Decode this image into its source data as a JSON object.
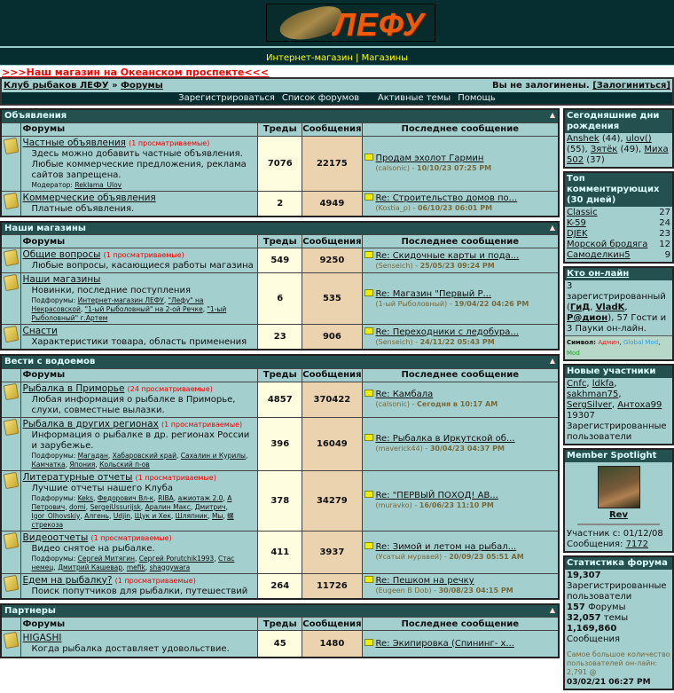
{
  "header": {
    "logo_text": "ЛЕФУ",
    "nav": [
      "Интернет-магазин",
      "Магазины"
    ],
    "nav_sep": " | ",
    "promo": ">>>Наш магазин на Океанском проспекте<<<"
  },
  "breadcrumb": {
    "root": "Клуб рыбаков ЛЕФУ",
    "sep": " » ",
    "current": "Форумы",
    "login_status": "Вы не залогинены.",
    "login_link": "[Залогиниться]"
  },
  "menu": [
    "Зарегистрироваться",
    "Список форумов",
    "Активные темы",
    "Помощь"
  ],
  "columns": {
    "forums": "Форумы",
    "threads": "Треды",
    "posts": "Сообщения",
    "last": "Последнее сообщение"
  },
  "categories": [
    {
      "title": "Объявления",
      "forums": [
        {
          "name": "Частные объявления",
          "viewing": "(1 просматриваемые)",
          "desc": "Здесь можно добавить частные объявления. Любые коммерческие предложения, реклама сайтов запрещена.",
          "sub_label": "Модератор:",
          "subs": [
            "Reklama_Ulov"
          ],
          "threads": "7076",
          "posts": "22175",
          "last_title": "Продам эхолот Гармин",
          "last_user": "(calsonic)",
          "last_date": "10/10/23 07:25 PM",
          "h": 40
        },
        {
          "name": "Коммерческие объявления",
          "viewing": "",
          "desc": "Платные объявления.",
          "threads": "2",
          "posts": "4949",
          "last_title": "Re: Строительство домов по...",
          "last_user": "(Kostia_p)",
          "last_date": "06/10/23 06:01 PM",
          "h": 22
        }
      ]
    },
    {
      "title": "Наши магазины",
      "forums": [
        {
          "name": "Общие вопросы",
          "viewing": "(1 просматриваемые)",
          "desc": "Любые вопросы, касающиеся работы магазина",
          "threads": "549",
          "posts": "9250",
          "last_title": "Re: Скидочные карты и пода...",
          "last_user": "(Senseich)",
          "last_date": "25/05/23 09:24 PM",
          "h": 23
        },
        {
          "name": "Наши магазины",
          "viewing": "",
          "desc": "Новинки, последние поступления",
          "sub_label": "Подфорумы:",
          "subs": [
            "Интернет-магазин ЛЕФУ",
            "\"Лефу\" на Некрасовской",
            "\"1-ый Рыболовный\" на 2-ой Речке",
            "\"1-ый Рыболовный\" г.Артем"
          ],
          "threads": "6",
          "posts": "535",
          "last_title": "Re: Магазин \"Первый Р...",
          "last_user": "(1-ый Рыболовный)",
          "last_date": "19/04/22 04:26 PM",
          "h": 37
        },
        {
          "name": "Снасти",
          "viewing": "",
          "desc": "Характеристики товара, область применения",
          "threads": "23",
          "posts": "906",
          "last_title": "Re: Переходники с ледобура...",
          "last_user": "(Senseich)",
          "last_date": "24/11/22 05:43 PM",
          "h": 23
        }
      ]
    },
    {
      "title": "Вести с водоемов",
      "forums": [
        {
          "name": "Рыбалка в Приморье",
          "viewing": "(24 просматриваемые)",
          "desc": "Любая информация о рыбалке в Приморье, слухи, совместные вылазки.",
          "threads": "4857",
          "posts": "370422",
          "last_title": "Re: Камбала",
          "last_user": "(calsonic)",
          "last_date": "Сегодня в 10:17 AM",
          "h": 30
        },
        {
          "name": "Рыбалка в других регионах",
          "viewing": "(1 просматриваемые)",
          "desc": "Информация о рыбалке в др. регионах России и зарубежье.",
          "sub_label": "Подфорумы:",
          "subs": [
            "Магадан",
            "Хабаровский край",
            "Сахалин и Курилы",
            "Камчатка",
            "Япония",
            "Кольский п-ов"
          ],
          "threads": "396",
          "posts": "16049",
          "last_title": "Re: Рыбалка в Иркутской об...",
          "last_user": "(maverick44)",
          "last_date": "30/04/23 04:37 PM",
          "h": 40
        },
        {
          "name": "Литературные отчеты",
          "viewing": "(1 просматриваемые)",
          "desc": "Лучшие отчеты нашего Клуба",
          "sub_label": "Подфорумы:",
          "subs": [
            "Keks",
            "Федорович Вл-к",
            "RIBA",
            "ажиотаж 2.0",
            "А Петрович",
            "domi",
            "SergeiUssurijsk",
            "Аралин Макс",
            "Дмитрич",
            "Igor_Olhovskiy",
            "Алгень",
            "Udjin",
            "Щук и Хек",
            "Шляпник",
            "Мы",
            "螺стрекоза"
          ],
          "threads": "378",
          "posts": "34279",
          "last_title": "Re: \"ПЕРВЫЙ ПОХОД! АВ...",
          "last_user": "(muravko)",
          "last_date": "16/06/23 11:10 PM",
          "h": 44
        },
        {
          "name": "Видеоотчеты",
          "viewing": "(1 просматриваемые)",
          "desc": "Видео снятое на рыбалке.",
          "sub_label": "Подфорумы:",
          "subs": [
            "Сергей Митягин",
            "Сергей Porutchik1993",
            "Стас немец",
            "Дмитрий Кашевар",
            "mefik",
            "shaggywara"
          ],
          "threads": "411",
          "posts": "3937",
          "last_title": "Re: Зимой и летом на рыбал...",
          "last_user": "(Усатый муравей)",
          "last_date": "20/09/23 05:51 AM",
          "h": 38
        },
        {
          "name": "Едем на рыбалку?",
          "viewing": "(1 просматриваемые)",
          "desc": "Поиск попутчиков для рыбалки, путешествий",
          "threads": "264",
          "posts": "11726",
          "last_title": "Re: Пешком на речку",
          "last_user": "(Eugeen B Dob)",
          "last_date": "30/08/23 04:15 PM",
          "h": 22
        }
      ]
    },
    {
      "title": "Партнеры",
      "forums": [
        {
          "name": "HIGASHI",
          "viewing": "",
          "desc": "Когда рыбалка доставляет удовольствие.",
          "threads": "45",
          "posts": "1480",
          "last_title": "Re: Экипировка (Спининг- х...",
          "last_user": "",
          "last_date": "",
          "h": 30
        }
      ]
    }
  ],
  "sidebar": {
    "birthdays": {
      "title": "Сегодняшние дни рождения",
      "people": [
        {
          "name": "Anshek",
          "age": "(44)"
        },
        {
          "name": "ulov()",
          "age": "(55)"
        },
        {
          "name": "Зятёк",
          "age": "(49)"
        },
        {
          "name": "Миха 502",
          "age": "(37)"
        }
      ]
    },
    "top": {
      "title": "Топ комментирующих (30 дней)",
      "rows": [
        {
          "name": "Classic",
          "n": "27"
        },
        {
          "name": "K-59",
          "n": "24"
        },
        {
          "name": "DJEK",
          "n": "23"
        },
        {
          "name": "Морской бродяга",
          "n": "12"
        },
        {
          "name": "Самоделкин5",
          "n": "9"
        }
      ]
    },
    "online": {
      "title": "Кто он-лайн",
      "pre": "3 зарегистрированный (",
      "users": [
        "ГиД",
        "VladK",
        "Р@дион"
      ],
      "post": "), 57 Гости и 3 Пауки он-лайн.",
      "sym_label": "Символ:",
      "sym": [
        {
          "t": "Админ",
          "c": "#e02020"
        },
        {
          "t": "Global Mod",
          "c": "#30a0e0"
        },
        {
          "t": "Mod",
          "c": "#20a020"
        }
      ]
    },
    "newmembers": {
      "title": "Новые участники",
      "users": [
        "Cnfc",
        "ldkfa",
        "sakhman75",
        "SergSilver",
        "Антоха99"
      ],
      "count_text": "19307 Зарегистрированные пользователи"
    },
    "spotlight": {
      "title": "Member Spotlight",
      "name": "Rev",
      "since_label": "Участник с:",
      "since": "01/12/08",
      "posts_label": "Сообщения:",
      "posts": "7172"
    },
    "stats": {
      "title": "Статистика форума",
      "users_n": "19,307",
      "users_l": "Зарегистрированные пользователи",
      "forums_n": "157",
      "forums_l": "Форумы",
      "threads_n": "32,057",
      "threads_l": "темы",
      "posts_n": "1,169,860",
      "posts_l": "Сообщения",
      "record": "Самое большое количество пользователей он-лайн: 2,791 @",
      "record_date": "03/02/21 06:27 PM"
    }
  }
}
